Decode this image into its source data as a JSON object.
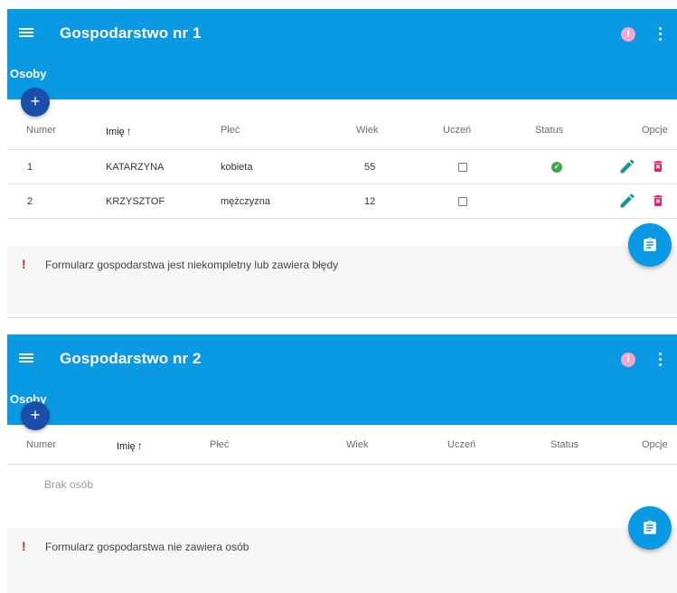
{
  "households": [
    {
      "title": "Gospodarstwo nr 1",
      "section": "Osoby",
      "add_label": "+",
      "alert_glyph": "!",
      "columns": [
        "Numer",
        "Imię",
        "Płeć",
        "Wiek",
        "Uczeń",
        "Status",
        "Opcje"
      ],
      "sort_arrow": "↑",
      "rows": [
        {
          "number": "1",
          "name": "KATARZYNA",
          "sex": "kobieta",
          "age": "55",
          "student": false,
          "status": "ok"
        },
        {
          "number": "2",
          "name": "KRZYSZTOF",
          "sex": "mężczyzna",
          "age": "12",
          "student": false,
          "status": ""
        }
      ],
      "empty_text": "",
      "warning_glyph": "!",
      "warning": "Formularz gospodarstwa jest niekompletny lub zawiera błędy"
    },
    {
      "title": "Gospodarstwo nr 2",
      "section": "Osoby",
      "add_label": "+",
      "alert_glyph": "!",
      "columns": [
        "Numer",
        "Imię",
        "Płeć",
        "Wiek",
        "Uczeń",
        "Status",
        "Opcje"
      ],
      "sort_arrow": "↑",
      "rows": [],
      "empty_text": "Brak osób",
      "warning_glyph": "!",
      "warning": "Formularz gospodarstwa nie zawiera osób"
    }
  ],
  "colors": {
    "header": "#0a9ae4",
    "add_button": "#1a4ea8",
    "alert": "#f3a8c9",
    "edit": "#0f9e8a",
    "delete": "#e3236b",
    "status_ok": "#3aa84e",
    "warning": "#e02020"
  },
  "icons": {
    "menu": "hamburger-menu-icon",
    "alert": "alert-circle-icon",
    "more": "more-vert-icon",
    "edit": "pencil-icon",
    "delete": "delete-box-icon",
    "status": "check-circle-icon",
    "fab": "clipboard-icon"
  }
}
